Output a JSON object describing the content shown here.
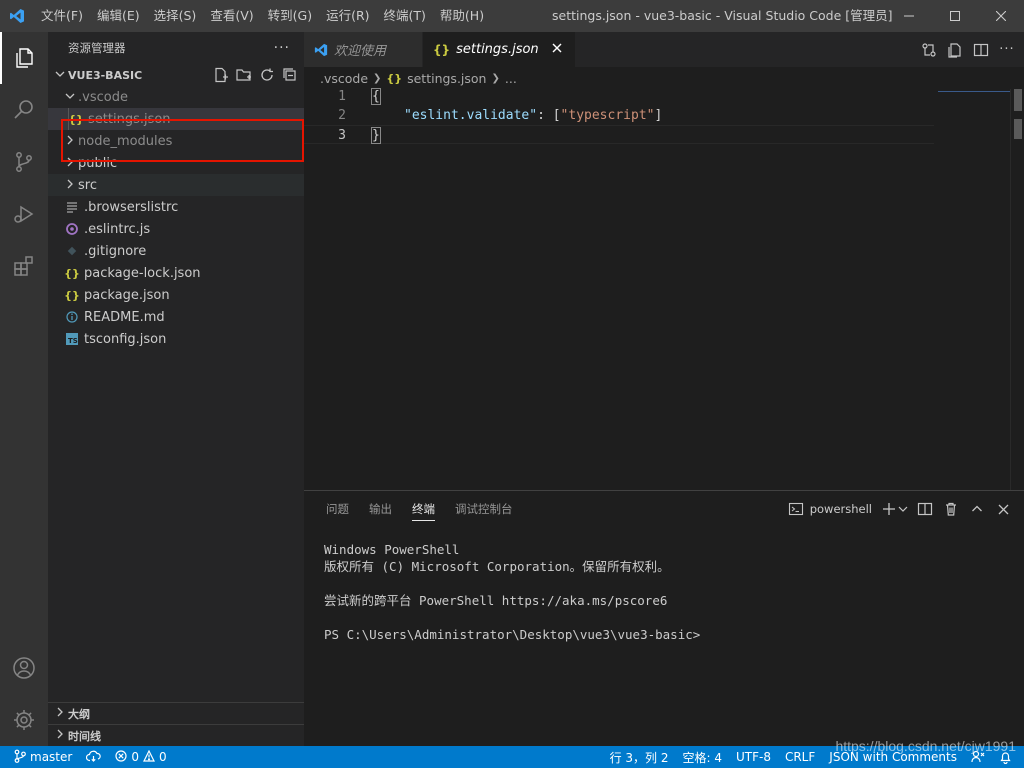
{
  "titlebar": {
    "menu": [
      "文件(F)",
      "编辑(E)",
      "选择(S)",
      "查看(V)",
      "转到(G)",
      "运行(R)",
      "终端(T)",
      "帮助(H)"
    ],
    "window_title": "settings.json - vue3-basic - Visual Studio Code [管理员]"
  },
  "sidebar": {
    "title": "资源管理器",
    "more": "···",
    "project": "VUE3-BASIC",
    "items": [
      {
        "label": ".vscode",
        "icon": "chevron-down",
        "kind": "folder"
      },
      {
        "label": "settings.json",
        "icon": "json-braces",
        "kind": "file"
      },
      {
        "label": "node_modules",
        "icon": "chevron-right",
        "kind": "folder"
      },
      {
        "label": "public",
        "icon": "chevron-right",
        "kind": "folder"
      },
      {
        "label": "src",
        "icon": "chevron-right",
        "kind": "folder"
      },
      {
        "label": ".browserslistrc",
        "icon": "lines-icon",
        "kind": "file"
      },
      {
        "label": ".eslintrc.js",
        "icon": "eslint-icon",
        "kind": "file"
      },
      {
        "label": ".gitignore",
        "icon": "git-icon",
        "kind": "file"
      },
      {
        "label": "package-lock.json",
        "icon": "json-braces",
        "kind": "file"
      },
      {
        "label": "package.json",
        "icon": "json-braces",
        "kind": "file"
      },
      {
        "label": "README.md",
        "icon": "info-icon",
        "kind": "file"
      },
      {
        "label": "tsconfig.json",
        "icon": "ts-icon",
        "kind": "file"
      }
    ],
    "outline": "大纲",
    "timeline": "时间线"
  },
  "tabs": [
    {
      "label": "欢迎使用",
      "active": false
    },
    {
      "label": "settings.json",
      "active": true
    }
  ],
  "breadcrumbs": [
    ".vscode",
    "settings.json",
    "..."
  ],
  "editor": {
    "line_numbers": [
      "1",
      "2",
      "3"
    ],
    "line1": "{",
    "line2_key": "\"eslint.validate\"",
    "line2_colon": ": [",
    "line2_value": "\"typescript\"",
    "line2_end": "]",
    "line3": "}"
  },
  "panel": {
    "tabs": [
      "问题",
      "输出",
      "终端",
      "调试控制台"
    ],
    "active_tab": "终端",
    "shell": "powershell",
    "terminal_lines": [
      "Windows PowerShell",
      "版权所有 (C) Microsoft Corporation。保留所有权利。",
      "",
      "尝试新的跨平台 PowerShell https://aka.ms/pscore6",
      "",
      "PS C:\\Users\\Administrator\\Desktop\\vue3\\vue3-basic>"
    ]
  },
  "statusbar": {
    "branch": "master",
    "errors": "0",
    "warnings": "0",
    "position": "行 3，列 2",
    "spaces": "空格: 4",
    "encoding": "UTF-8",
    "eol": "CRLF",
    "language": "JSON with Comments"
  },
  "watermark": "https://blog.csdn.net/cjw1991",
  "colors": {
    "accent": "#007acc",
    "highlight_border": "#e51400",
    "json_icon": "#cbcb41"
  }
}
